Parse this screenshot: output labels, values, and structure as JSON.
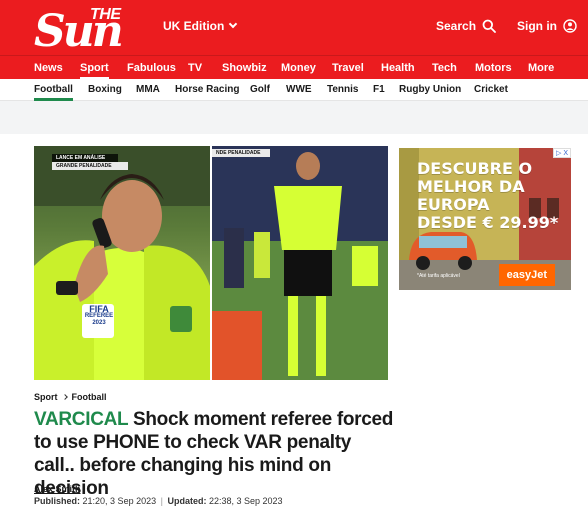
{
  "header": {
    "logo_the": "THE",
    "logo_sun": "Sun",
    "edition": "UK Edition",
    "search_label": "Search",
    "signin_label": "Sign in",
    "brand_color": "#eb1c1f"
  },
  "main_nav": [
    {
      "label": "News",
      "active": false
    },
    {
      "label": "Sport",
      "active": true
    },
    {
      "label": "Fabulous",
      "active": false
    },
    {
      "label": "TV",
      "active": false
    },
    {
      "label": "Showbiz",
      "active": false
    },
    {
      "label": "Money",
      "active": false
    },
    {
      "label": "Travel",
      "active": false
    },
    {
      "label": "Health",
      "active": false
    },
    {
      "label": "Tech",
      "active": false
    },
    {
      "label": "Motors",
      "active": false
    },
    {
      "label": "More",
      "active": false
    }
  ],
  "sub_nav": [
    {
      "label": "Football",
      "active": true
    },
    {
      "label": "Boxing",
      "active": false
    },
    {
      "label": "MMA",
      "active": false
    },
    {
      "label": "Horse Racing",
      "active": false
    },
    {
      "label": "Golf",
      "active": false
    },
    {
      "label": "WWE",
      "active": false
    },
    {
      "label": "Tennis",
      "active": false
    },
    {
      "label": "F1",
      "active": false
    },
    {
      "label": "Rugby Union",
      "active": false
    },
    {
      "label": "Cricket",
      "active": false
    }
  ],
  "hero": {
    "left_tag_1": "LANCE EM ANÁLISE",
    "left_tag_2": "GRANDE PENALIDADE",
    "right_tag": "NDE PENALIDADE",
    "badge_fifa": "FIFA",
    "badge_referee": "REFEREE",
    "badge_year": "2023"
  },
  "ad": {
    "headline": [
      "DESCUBRE O",
      "MELHOR DA EUROPA",
      "DESDE € 29.99*"
    ],
    "brand": "easyJet",
    "fineprint": "*Até tarifa aplicável"
  },
  "article": {
    "breadcrumb": [
      "Sport",
      "Football"
    ],
    "kicker": "VARCICAL",
    "headline": "Shock moment referee forced to use PHONE to check VAR penalty call.. before changing his mind on decision",
    "author": "Alex Smith",
    "published_label": "Published:",
    "published": "21:20, 3 Sep 2023",
    "separator": "|",
    "updated_label": "Updated:",
    "updated": "22:38, 3 Sep 2023",
    "kicker_color": "#1f8a4c"
  }
}
